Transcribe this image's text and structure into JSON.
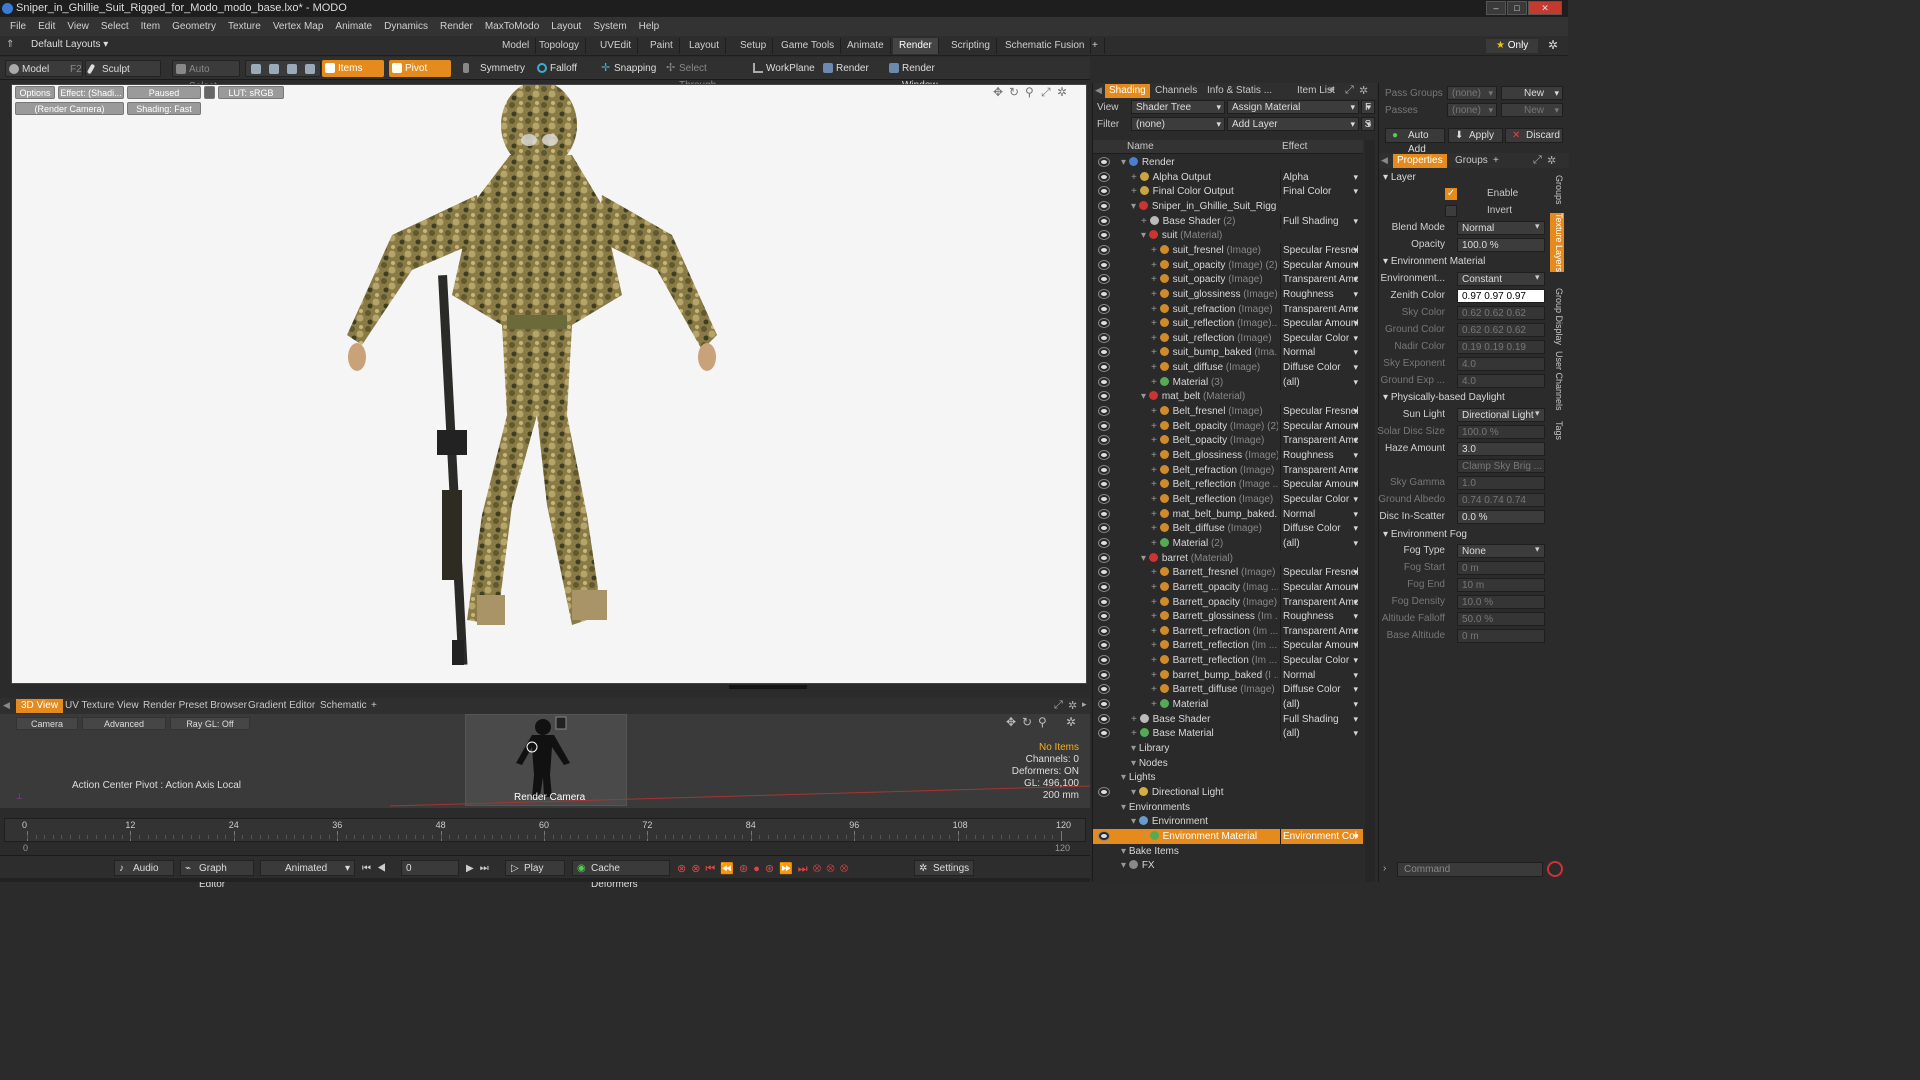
{
  "window": {
    "title": "Sniper_in_Ghillie_Suit_Rigged_for_Modo_modo_base.lxo* - MODO"
  },
  "menu": [
    "File",
    "Edit",
    "View",
    "Select",
    "Item",
    "Geometry",
    "Texture",
    "Vertex Map",
    "Animate",
    "Dynamics",
    "Render",
    "MaxToModo",
    "Layout",
    "System",
    "Help"
  ],
  "layout": {
    "preset": "Default Layouts ▾",
    "tabs": [
      "Model",
      "Topology",
      "UVEdit",
      "Paint",
      "Layout",
      "Setup",
      "Game Tools",
      "Animate",
      "Render",
      "Scripting",
      "Schematic Fusion",
      "+"
    ],
    "active": "Render",
    "only": "Only"
  },
  "toolbar": {
    "model": "Model",
    "f2": "F2",
    "sculpt": "Sculpt",
    "auto_select": "Auto Select",
    "items": "Items",
    "pivot": "Pivot",
    "symmetry": "Symmetry",
    "falloff": "Falloff",
    "snapping": "Snapping",
    "select_through": "Select Through",
    "workplane": "WorkPlane",
    "render": "Render",
    "render_window": "Render Window"
  },
  "viewport": {
    "options": "Options",
    "effect": "Effect: (Shadi...",
    "paused": "Paused",
    "lut": "LUT: sRGB",
    "camera": "(Render Camera)",
    "shading": "Shading: Fast"
  },
  "bottom_tabs": [
    "3D View",
    "UV Texture View",
    "Render Preset Browser",
    "Gradient Editor",
    "Schematic",
    "+"
  ],
  "preview": {
    "camera": "Camera",
    "advanced": "Advanced",
    "raygl": "Ray GL: Off",
    "action_center": "Action Center Pivot : Action Axis Local",
    "render_camera": "Render Camera",
    "no_items": "No Items",
    "channels": "Channels: 0",
    "deformers": "Deformers: ON",
    "gl": "GL: 496,100",
    "size": "200 mm"
  },
  "timeline": {
    "ticks": [
      "0",
      "12",
      "24",
      "36",
      "48",
      "60",
      "72",
      "84",
      "96",
      "108",
      "120"
    ],
    "sub": [
      "0",
      "120"
    ]
  },
  "transport": {
    "audio": "Audio",
    "graph_editor": "Graph Editor",
    "animated": "Animated",
    "frame": "0",
    "play": "Play",
    "cache": "Cache Deformers",
    "settings": "Settings"
  },
  "shading": {
    "tabs": [
      "Shading",
      "Channels",
      "Info & Statis ...",
      "Item List",
      "+"
    ],
    "view_label": "View",
    "view_value": "Shader Tree",
    "assign": "Assign Material",
    "filter_label": "Filter",
    "filter_value": "(none)",
    "add_layer": "Add Layer",
    "col_name": "Name",
    "col_effect": "Effect",
    "rows": [
      {
        "indent": 0,
        "icon": "#4a7fd0",
        "name": "Render",
        "tag": "",
        "effect": "",
        "eye": true,
        "noef": true
      },
      {
        "indent": 1,
        "icon": "#c9a441",
        "name": "Alpha Output",
        "tag": "",
        "effect": "Alpha",
        "eye": true
      },
      {
        "indent": 1,
        "icon": "#c9a441",
        "name": "Final Color Output",
        "tag": "",
        "effect": "Final Color",
        "eye": true
      },
      {
        "indent": 1,
        "icon": "#cc3333",
        "name": "Sniper_in_Ghillie_Suit_Rigg ...",
        "tag": "",
        "effect": "",
        "eye": true,
        "noef": true
      },
      {
        "indent": 2,
        "icon": "#bbbbbb",
        "name": "Base Shader",
        "tag": " (2)",
        "effect": "Full Shading",
        "eye": true
      },
      {
        "indent": 2,
        "icon": "#cc3333",
        "name": "suit",
        "tag": " (Material)",
        "effect": "",
        "eye": true,
        "noef": true
      },
      {
        "indent": 3,
        "icon": "#d08a2a",
        "name": "suit_fresnel",
        "tag": " (Image)",
        "effect": "Specular Fresnel",
        "eye": true
      },
      {
        "indent": 3,
        "icon": "#d08a2a",
        "name": "suit_opacity",
        "tag": " (Image) (2)",
        "effect": "Specular Amount",
        "eye": true
      },
      {
        "indent": 3,
        "icon": "#d08a2a",
        "name": "suit_opacity",
        "tag": " (Image)",
        "effect": "Transparent Amo ...",
        "eye": true
      },
      {
        "indent": 3,
        "icon": "#d08a2a",
        "name": "suit_glossiness",
        "tag": " (Image)",
        "effect": "Roughness",
        "eye": true
      },
      {
        "indent": 3,
        "icon": "#d08a2a",
        "name": "suit_refraction",
        "tag": " (Image)",
        "effect": "Transparent Amo ...",
        "eye": true
      },
      {
        "indent": 3,
        "icon": "#d08a2a",
        "name": "suit_reflection",
        "tag": " (Image)...",
        "effect": "Specular Amount",
        "eye": true
      },
      {
        "indent": 3,
        "icon": "#d08a2a",
        "name": "suit_reflection",
        "tag": " (Image)",
        "effect": "Specular Color",
        "eye": true
      },
      {
        "indent": 3,
        "icon": "#d08a2a",
        "name": "suit_bump_baked",
        "tag": " (Ima...",
        "effect": "Normal",
        "eye": true
      },
      {
        "indent": 3,
        "icon": "#d08a2a",
        "name": "suit_diffuse",
        "tag": " (Image)",
        "effect": "Diffuse Color",
        "eye": true
      },
      {
        "indent": 3,
        "icon": "#55aa55",
        "name": "Material",
        "tag": " (3)",
        "effect": "(all)",
        "eye": true
      },
      {
        "indent": 2,
        "icon": "#cc3333",
        "name": "mat_belt",
        "tag": " (Material)",
        "effect": "",
        "eye": true,
        "noef": true
      },
      {
        "indent": 3,
        "icon": "#d08a2a",
        "name": "Belt_fresnel",
        "tag": " (Image)",
        "effect": "Specular Fresnel",
        "eye": true
      },
      {
        "indent": 3,
        "icon": "#d08a2a",
        "name": "Belt_opacity",
        "tag": " (Image) (2)",
        "effect": "Specular Amount",
        "eye": true
      },
      {
        "indent": 3,
        "icon": "#d08a2a",
        "name": "Belt_opacity",
        "tag": " (Image)",
        "effect": "Transparent Amo ...",
        "eye": true
      },
      {
        "indent": 3,
        "icon": "#d08a2a",
        "name": "Belt_glossiness",
        "tag": " (Image)",
        "effect": "Roughness",
        "eye": true
      },
      {
        "indent": 3,
        "icon": "#d08a2a",
        "name": "Belt_refraction",
        "tag": " (Image)",
        "effect": "Transparent Amo ...",
        "eye": true
      },
      {
        "indent": 3,
        "icon": "#d08a2a",
        "name": "Belt_reflection",
        "tag": " (Image ...",
        "effect": "Specular Amount",
        "eye": true
      },
      {
        "indent": 3,
        "icon": "#d08a2a",
        "name": "Belt_reflection",
        "tag": " (Image)",
        "effect": "Specular Color",
        "eye": true
      },
      {
        "indent": 3,
        "icon": "#d08a2a",
        "name": "mat_belt_bump_baked...",
        "tag": "",
        "effect": "Normal",
        "eye": true
      },
      {
        "indent": 3,
        "icon": "#d08a2a",
        "name": "Belt_diffuse",
        "tag": " (Image)",
        "effect": "Diffuse Color",
        "eye": true
      },
      {
        "indent": 3,
        "icon": "#55aa55",
        "name": "Material",
        "tag": " (2)",
        "effect": "(all)",
        "eye": true
      },
      {
        "indent": 2,
        "icon": "#cc3333",
        "name": "barret",
        "tag": " (Material)",
        "effect": "",
        "eye": true,
        "noef": true
      },
      {
        "indent": 3,
        "icon": "#d08a2a",
        "name": "Barrett_fresnel",
        "tag": " (Image)",
        "effect": "Specular Fresnel",
        "eye": true
      },
      {
        "indent": 3,
        "icon": "#d08a2a",
        "name": "Barrett_opacity",
        "tag": " (Imag ...",
        "effect": "Specular Amount",
        "eye": true
      },
      {
        "indent": 3,
        "icon": "#d08a2a",
        "name": "Barrett_opacity",
        "tag": " (Image)",
        "effect": "Transparent Amo ...",
        "eye": true
      },
      {
        "indent": 3,
        "icon": "#d08a2a",
        "name": "Barrett_glossiness",
        "tag": " (Im ...",
        "effect": "Roughness",
        "eye": true
      },
      {
        "indent": 3,
        "icon": "#d08a2a",
        "name": "Barrett_refraction",
        "tag": " (Im ...",
        "effect": "Transparent Amo ...",
        "eye": true
      },
      {
        "indent": 3,
        "icon": "#d08a2a",
        "name": "Barrett_reflection",
        "tag": " (Im ...",
        "effect": "Specular Amount",
        "eye": true
      },
      {
        "indent": 3,
        "icon": "#d08a2a",
        "name": "Barrett_reflection",
        "tag": " (Im ...",
        "effect": "Specular Color",
        "eye": true
      },
      {
        "indent": 3,
        "icon": "#d08a2a",
        "name": "barret_bump_baked",
        "tag": " (I ...",
        "effect": "Normal",
        "eye": true
      },
      {
        "indent": 3,
        "icon": "#d08a2a",
        "name": "Barrett_diffuse",
        "tag": " (Image)",
        "effect": "Diffuse Color",
        "eye": true
      },
      {
        "indent": 3,
        "icon": "#55aa55",
        "name": "Material",
        "tag": "",
        "effect": "(all)",
        "eye": true
      },
      {
        "indent": 1,
        "icon": "#bbbbbb",
        "name": "Base Shader",
        "tag": "",
        "effect": "Full Shading",
        "eye": true
      },
      {
        "indent": 1,
        "icon": "#55aa55",
        "name": "Base Material",
        "tag": "",
        "effect": "(all)",
        "eye": true
      },
      {
        "indent": 1,
        "icon": "",
        "name": "Library",
        "tag": "",
        "effect": "",
        "eye": false,
        "noef": true
      },
      {
        "indent": 1,
        "icon": "",
        "name": "Nodes",
        "tag": "",
        "effect": "",
        "eye": false,
        "noef": true
      },
      {
        "indent": 0,
        "icon": "",
        "name": "Lights",
        "tag": "",
        "effect": "",
        "eye": false,
        "noef": true
      },
      {
        "indent": 1,
        "icon": "#d0b040",
        "name": "Directional Light",
        "tag": "",
        "effect": "",
        "eye": true,
        "noef": true
      },
      {
        "indent": 0,
        "icon": "",
        "name": "Environments",
        "tag": "",
        "effect": "",
        "eye": false,
        "noef": true
      },
      {
        "indent": 1,
        "icon": "#6a9ad0",
        "name": "Environment",
        "tag": "",
        "effect": "",
        "eye": false,
        "noef": true
      },
      {
        "indent": 2,
        "icon": "#55aa55",
        "name": "Environment Material",
        "tag": "",
        "effect": "Environment Color",
        "eye": true,
        "sel": true
      },
      {
        "indent": 0,
        "icon": "",
        "name": "Bake Items",
        "tag": "",
        "effect": "",
        "eye": false,
        "noef": true
      },
      {
        "indent": 0,
        "icon": "#888888",
        "name": "FX",
        "tag": "",
        "effect": "",
        "eye": false,
        "noef": true
      }
    ]
  },
  "props": {
    "pass_groups": "Pass Groups",
    "pass_none": "(none)",
    "new": "New",
    "passes": "Passes",
    "passes_none": "(none)",
    "new2": "New",
    "auto_add": "Auto Add",
    "apply": "Apply",
    "discard": "Discard",
    "tabs": [
      "Properties",
      "Groups",
      "+"
    ],
    "layer": "Layer",
    "enable": "Enable",
    "invert": "Invert",
    "env_material": "Environment Material",
    "pb_daylight": "Physically-based Daylight",
    "env_fog": "Environment Fog",
    "rows": [
      {
        "label": "Blend Mode",
        "value": "Normal",
        "dd": true
      },
      {
        "label": "Opacity",
        "value": "100.0 %"
      },
      {
        "label": "Environment...",
        "value": "Constant",
        "dd": true
      },
      {
        "label": "Zenith Color",
        "value": "0.97  0.97  0.97",
        "white": true
      },
      {
        "label": "Sky Color",
        "value": "0.62  0.62  0.62",
        "dim": true
      },
      {
        "label": "Ground Color",
        "value": "0.62  0.62  0.62",
        "dim": true
      },
      {
        "label": "Nadir Color",
        "value": "0.19  0.19  0.19",
        "dim": true
      },
      {
        "label": "Sky Exponent",
        "value": "4.0",
        "dim": true
      },
      {
        "label": "Ground Exp ...",
        "value": "4.0",
        "dim": true
      },
      {
        "label": "Sun Light",
        "value": "Directional Light",
        "dd": true
      },
      {
        "label": "Solar Disc Size",
        "value": "100.0 %",
        "dim": true
      },
      {
        "label": "Haze Amount",
        "value": "3.0"
      },
      {
        "label": "",
        "value": "Clamp Sky Brig ...",
        "dim": true
      },
      {
        "label": "Sky Gamma",
        "value": "1.0",
        "dim": true
      },
      {
        "label": "Ground Albedo",
        "value": "0.74  0.74  0.74",
        "dim": true
      },
      {
        "label": "Disc In-Scatter",
        "value": "0.0 %"
      },
      {
        "label": "Fog Type",
        "value": "None",
        "dd": true
      },
      {
        "label": "Fog Start",
        "value": "0 m",
        "dim": true
      },
      {
        "label": "Fog End",
        "value": "10 m",
        "dim": true
      },
      {
        "label": "Fog Density",
        "value": "10.0 %",
        "dim": true
      },
      {
        "label": "Altitude Falloff",
        "value": "50.0 %",
        "dim": true
      },
      {
        "label": "Base Altitude",
        "value": "0 m",
        "dim": true
      }
    ],
    "side_tabs": [
      "Groups",
      "Texture Layers",
      "Group Display",
      "User Channels",
      "Tags"
    ],
    "command": "Command"
  }
}
